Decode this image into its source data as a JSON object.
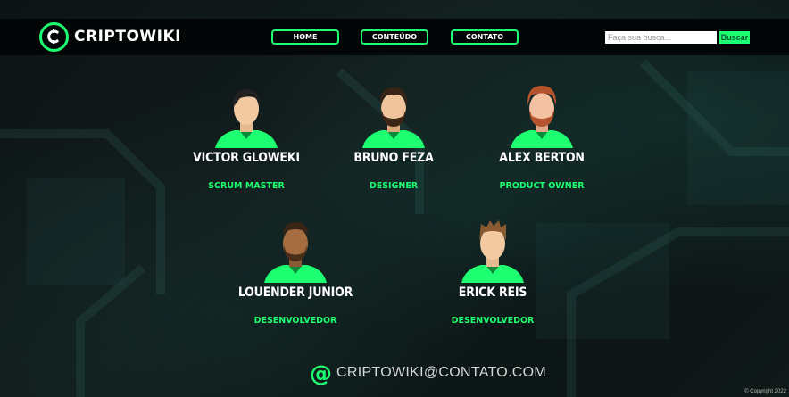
{
  "header": {
    "logo_text": "CRIPTOWIKI",
    "nav": [
      {
        "label": "HOME"
      },
      {
        "label": "CONTEÚDO"
      },
      {
        "label": "CONTATO"
      }
    ],
    "search": {
      "placeholder": "Faça sua busca...",
      "value": "",
      "button_label": "Buscar"
    }
  },
  "team": [
    {
      "name": "VICTOR GLOWEKI",
      "role": "SCRUM MASTER",
      "avatar": "avatar-short-dark-hair"
    },
    {
      "name": "BRUNO FEZA",
      "role": "DESIGNER",
      "avatar": "avatar-bearded"
    },
    {
      "name": "ALEX BERTON",
      "role": "PRODUCT OWNER",
      "avatar": "avatar-red-hair-beard"
    },
    {
      "name": "LOUENDER JUNIOR",
      "role": "DESENVOLVEDOR",
      "avatar": "avatar-dark-skin-beard"
    },
    {
      "name": "ERICK REIS",
      "role": "DESENVOLVEDOR",
      "avatar": "avatar-light-brown-hair"
    }
  ],
  "footer": {
    "contact_icon": "at-icon",
    "contact_email": "CRIPTOWIKI@CONTATO.COM",
    "copyright": "© Copyright 2022"
  },
  "colors": {
    "accent": "#1dff70",
    "header_bg": "#030606",
    "page_bg": "#0f1818"
  }
}
